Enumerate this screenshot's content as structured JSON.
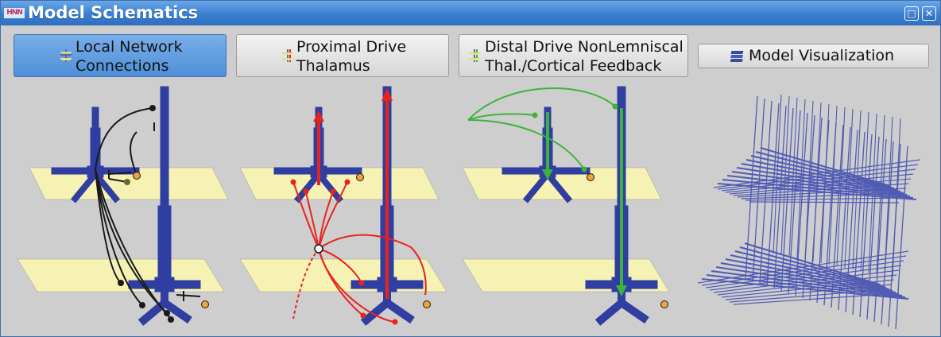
{
  "window": {
    "title": "Model Schematics",
    "app_icon_text": "HNN",
    "maximize_glyph": "□",
    "close_glyph": "✕"
  },
  "tabs": [
    {
      "label": "Local Network\nConnections",
      "icon": "network-icon",
      "active": true
    },
    {
      "label": "Proximal Drive\nThalamus",
      "icon": "proximal-drive-icon",
      "active": false
    },
    {
      "label": "Distal Drive NonLemniscal\nThal./Cortical Feedback",
      "icon": "distal-drive-icon",
      "active": false
    },
    {
      "label": "Model Visualization",
      "icon": "model-layers-icon",
      "active": false
    }
  ],
  "colors": {
    "neuron": "#2f3ea0",
    "plane": "#f5f2b4",
    "proximal": "#e8231c",
    "distal": "#3cb43c",
    "input_dot": "#f2a23a",
    "connection": "#1a1a1a"
  }
}
